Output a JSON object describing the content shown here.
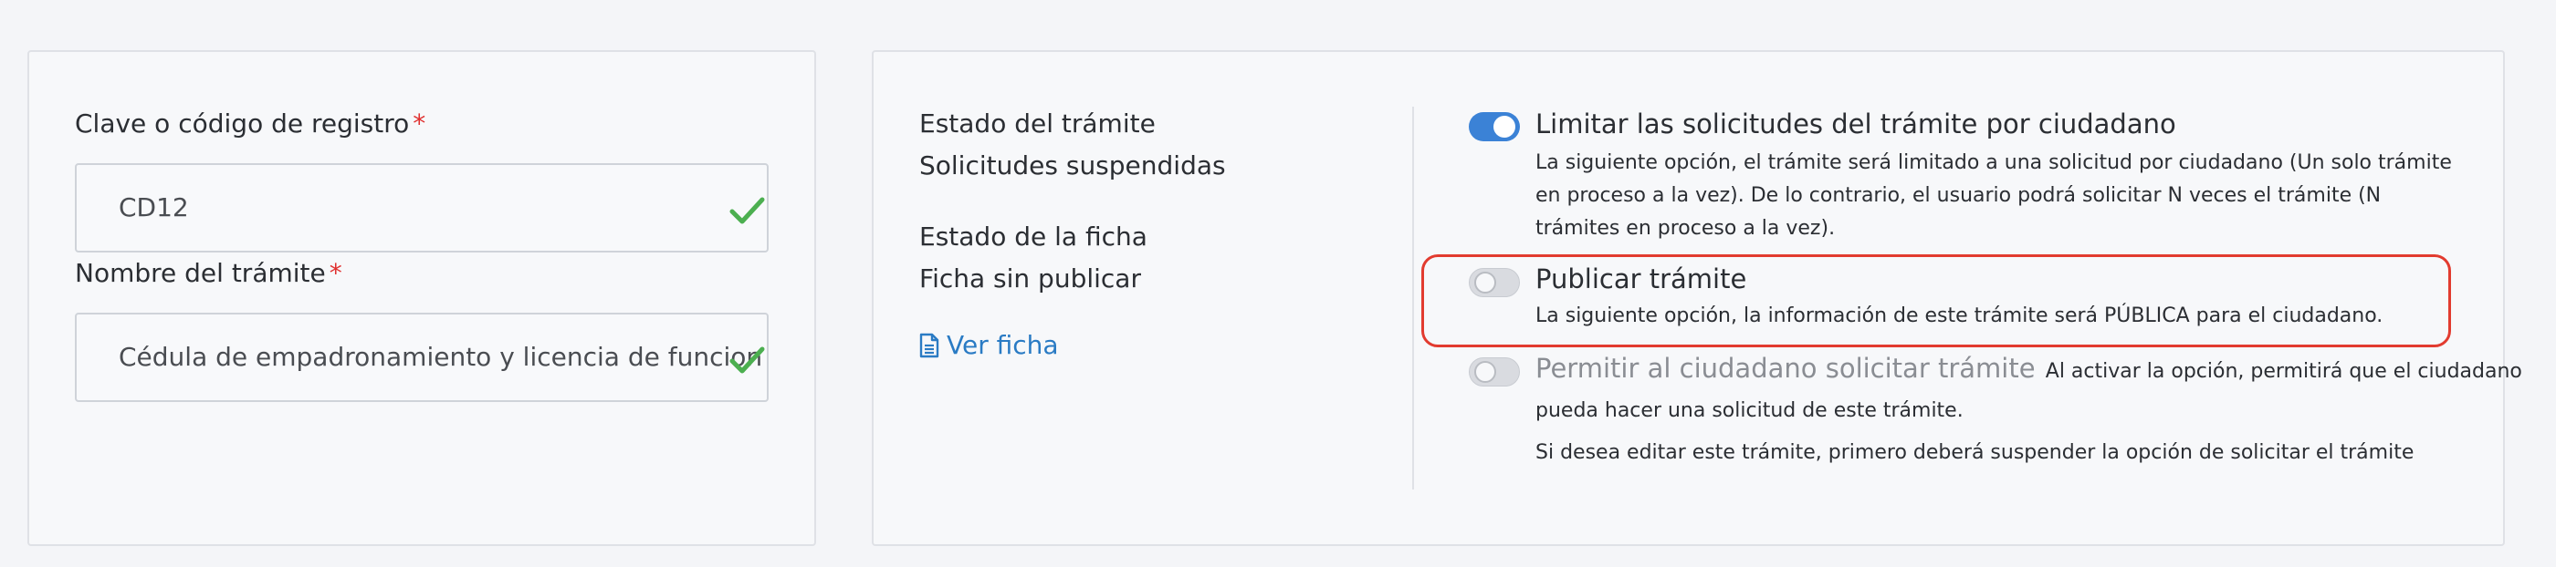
{
  "left": {
    "registry_label": "Clave o código de registro",
    "registry_required": "*",
    "registry_value": "CD12",
    "name_label": "Nombre del trámite",
    "name_required": "*",
    "name_value": "Cédula de empadronamiento y licencia de funcion"
  },
  "right": {
    "status_heading": "Estado del trámite",
    "status_value": "Solicitudes suspendidas",
    "sheet_heading": "Estado de la ficha",
    "sheet_value": "Ficha sin publicar",
    "view_sheet_link": "Ver ficha",
    "options": [
      {
        "title": "Limitar las solicitudes del trámite por ciudadano",
        "state": "on",
        "description": "La siguiente opción, el trámite será limitado a una solicitud por ciudadano (Un solo trámite en proceso a la vez). De lo contrario, el usuario podrá solicitar N veces el trámite (N trámites en proceso a la vez)."
      },
      {
        "title": "Publicar trámite",
        "state": "off",
        "description": "La siguiente opción, la información de este trámite será PÚBLICA para el ciudadano."
      },
      {
        "title": "Permitir al ciudadano solicitar trámite",
        "state": "off",
        "inline_description": "Al activar la opción, permitirá que el ciudadano",
        "description_line2": "pueda hacer una solicitud de este trámite.",
        "note": "Si desea editar este trámite, primero deberá suspender la opción de solicitar el trámite"
      }
    ]
  },
  "colors": {
    "accent": "#3b82d6",
    "link": "#2a7bc4",
    "required": "#e0302f",
    "valid_check": "#4caf50",
    "highlight": "#e23b2f"
  },
  "icons": {
    "valid": "check-icon",
    "document": "file-text-icon"
  }
}
